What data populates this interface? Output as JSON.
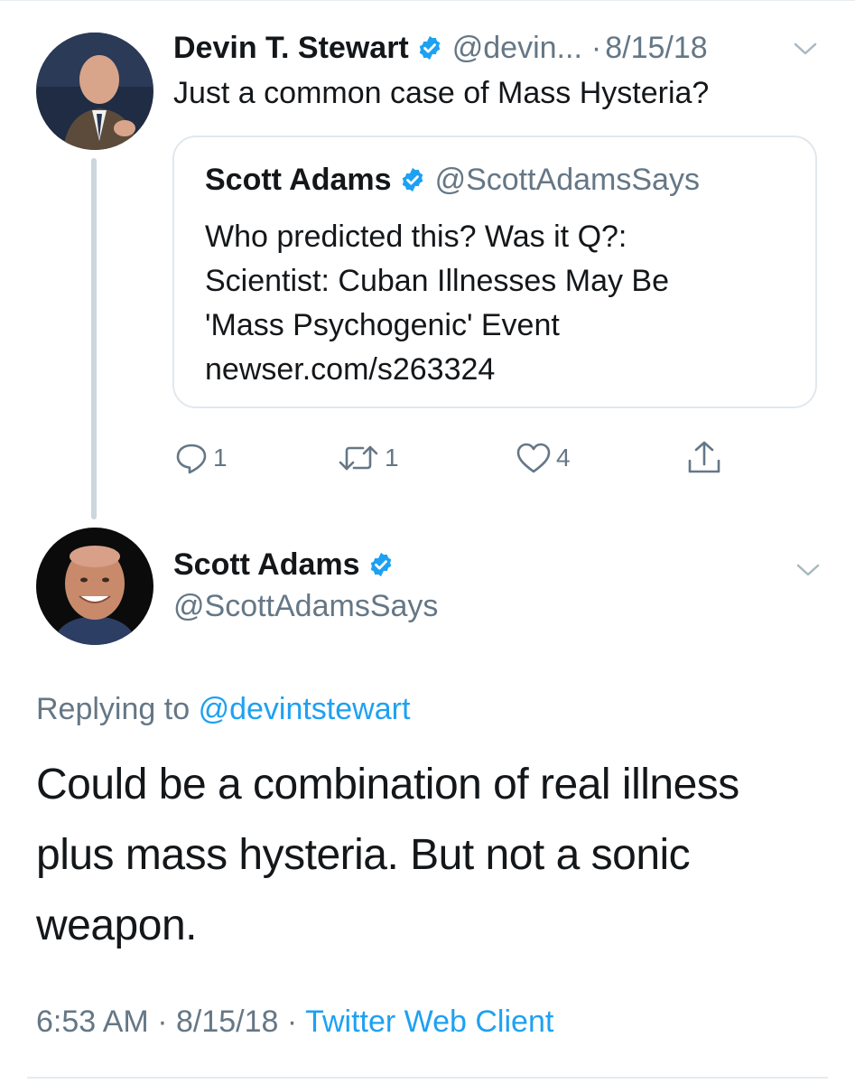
{
  "parent_tweet": {
    "display_name": "Devin T. Stewart",
    "handle": "@devin...",
    "separator": "·",
    "date": "8/15/18",
    "text": "Just a common case of Mass Hysteria?",
    "quoted_tweet": {
      "display_name": "Scott Adams",
      "handle": "@ScottAdamsSays",
      "lines": [
        "Who predicted this? Was it Q?:",
        "Scientist: Cuban Illnesses May Be",
        "'Mass Psychogenic' Event",
        "newser.com/s263324"
      ]
    },
    "actions": {
      "reply_count": "1",
      "retweet_count": "1",
      "like_count": "4"
    }
  },
  "reply_tweet": {
    "display_name": "Scott Adams",
    "handle": "@ScottAdamsSays",
    "replying_to_prefix": "Replying to",
    "replying_to_handle": "@devintstewart",
    "body_lines": [
      "Could be a combination of real illness",
      "plus mass hysteria. But not a sonic",
      "weapon."
    ],
    "time": "6:53 AM",
    "date": "8/15/18",
    "separator": "·",
    "source": "Twitter Web Client"
  },
  "icons": {
    "verified": "verified-badge-icon",
    "caret": "chevron-down-icon",
    "reply": "reply-bubble-icon",
    "retweet": "retweet-icon",
    "like": "heart-icon",
    "share": "share-icon"
  },
  "colors": {
    "accent": "#1da1f2",
    "text_primary": "#14171a",
    "text_secondary": "#657786",
    "border": "#e1e8ed",
    "thread_line": "#ccd6dd"
  }
}
